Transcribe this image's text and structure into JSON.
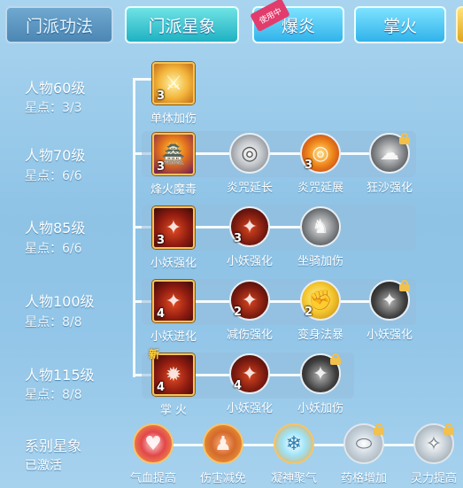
{
  "tabs": [
    {
      "label": "门派功法",
      "state": "inactive"
    },
    {
      "label": "门派星象",
      "state": "active"
    },
    {
      "label": "爆炎",
      "state": "selected",
      "badge": "使用中"
    },
    {
      "label": "掌火",
      "state": "inactive"
    },
    {
      "label": "",
      "state": "partial"
    }
  ],
  "rows": [
    {
      "level": "人物60级",
      "points": "星点：3/3",
      "nodes": [
        {
          "label": "单体加伤",
          "icon": "slash-icon",
          "count": "3",
          "locked": false,
          "new": false
        }
      ]
    },
    {
      "level": "人物70级",
      "points": "星点：6/6",
      "nodes": [
        {
          "label": "烽火魔毒",
          "icon": "fire-tower-icon",
          "count": "3",
          "locked": false,
          "new": false
        },
        {
          "label": "炎咒延长",
          "icon": "silver-rune-icon",
          "count": "",
          "locked": false,
          "new": false
        },
        {
          "label": "炎咒延展",
          "icon": "fire-rune-icon",
          "count": "3",
          "locked": false,
          "new": false
        },
        {
          "label": "狂沙强化",
          "icon": "sand-storm-icon",
          "count": "",
          "locked": true,
          "new": false
        }
      ]
    },
    {
      "level": "人物85级",
      "points": "星点：6/6",
      "nodes": [
        {
          "label": "小妖强化",
          "icon": "demon-claw-icon",
          "count": "3",
          "locked": false,
          "new": false
        },
        {
          "label": "小妖强化",
          "icon": "demon-claw-icon",
          "count": "3",
          "locked": false,
          "new": false
        },
        {
          "label": "坐骑加伤",
          "icon": "mount-icon",
          "count": "",
          "locked": false,
          "new": false
        }
      ]
    },
    {
      "level": "人物100级",
      "points": "星点：8/8",
      "nodes": [
        {
          "label": "小妖进化",
          "icon": "demon-claw-icon",
          "count": "4",
          "locked": false,
          "new": false
        },
        {
          "label": "减伤强化",
          "icon": "demon-claw-icon",
          "count": "2",
          "locked": false,
          "new": false
        },
        {
          "label": "变身法暴",
          "icon": "golden-fist-icon",
          "count": "2",
          "locked": false,
          "new": false
        },
        {
          "label": "小妖强化",
          "icon": "dark-claw-icon",
          "count": "",
          "locked": true,
          "new": false
        }
      ]
    },
    {
      "level": "人物115级",
      "points": "星点：8/8",
      "nodes": [
        {
          "label": "掌 火",
          "icon": "fire-demon-icon",
          "count": "4",
          "locked": false,
          "new": true,
          "new_label": "新"
        },
        {
          "label": "小妖强化",
          "icon": "demon-claw-icon",
          "count": "4",
          "locked": false,
          "new": false
        },
        {
          "label": "小妖加伤",
          "icon": "dark-claw-icon",
          "count": "",
          "locked": true,
          "new": false
        }
      ]
    }
  ],
  "series": {
    "title": "系别星象",
    "status": "已激活",
    "nodes": [
      {
        "label": "气血提高",
        "icon": "heart-icon",
        "locked": false
      },
      {
        "label": "伤害减免",
        "icon": "body-icon",
        "locked": false
      },
      {
        "label": "凝神聚气",
        "icon": "meditation-icon",
        "locked": false
      },
      {
        "label": "药格增加",
        "icon": "pill-icon",
        "locked": true
      },
      {
        "label": "灵力提高",
        "icon": "spirit-icon",
        "locked": true
      }
    ]
  },
  "colors": {
    "active_tab": "#1fb1c2",
    "tab": "#2e90d6",
    "line": "#f4fbff",
    "lock": "#f2c04c"
  }
}
